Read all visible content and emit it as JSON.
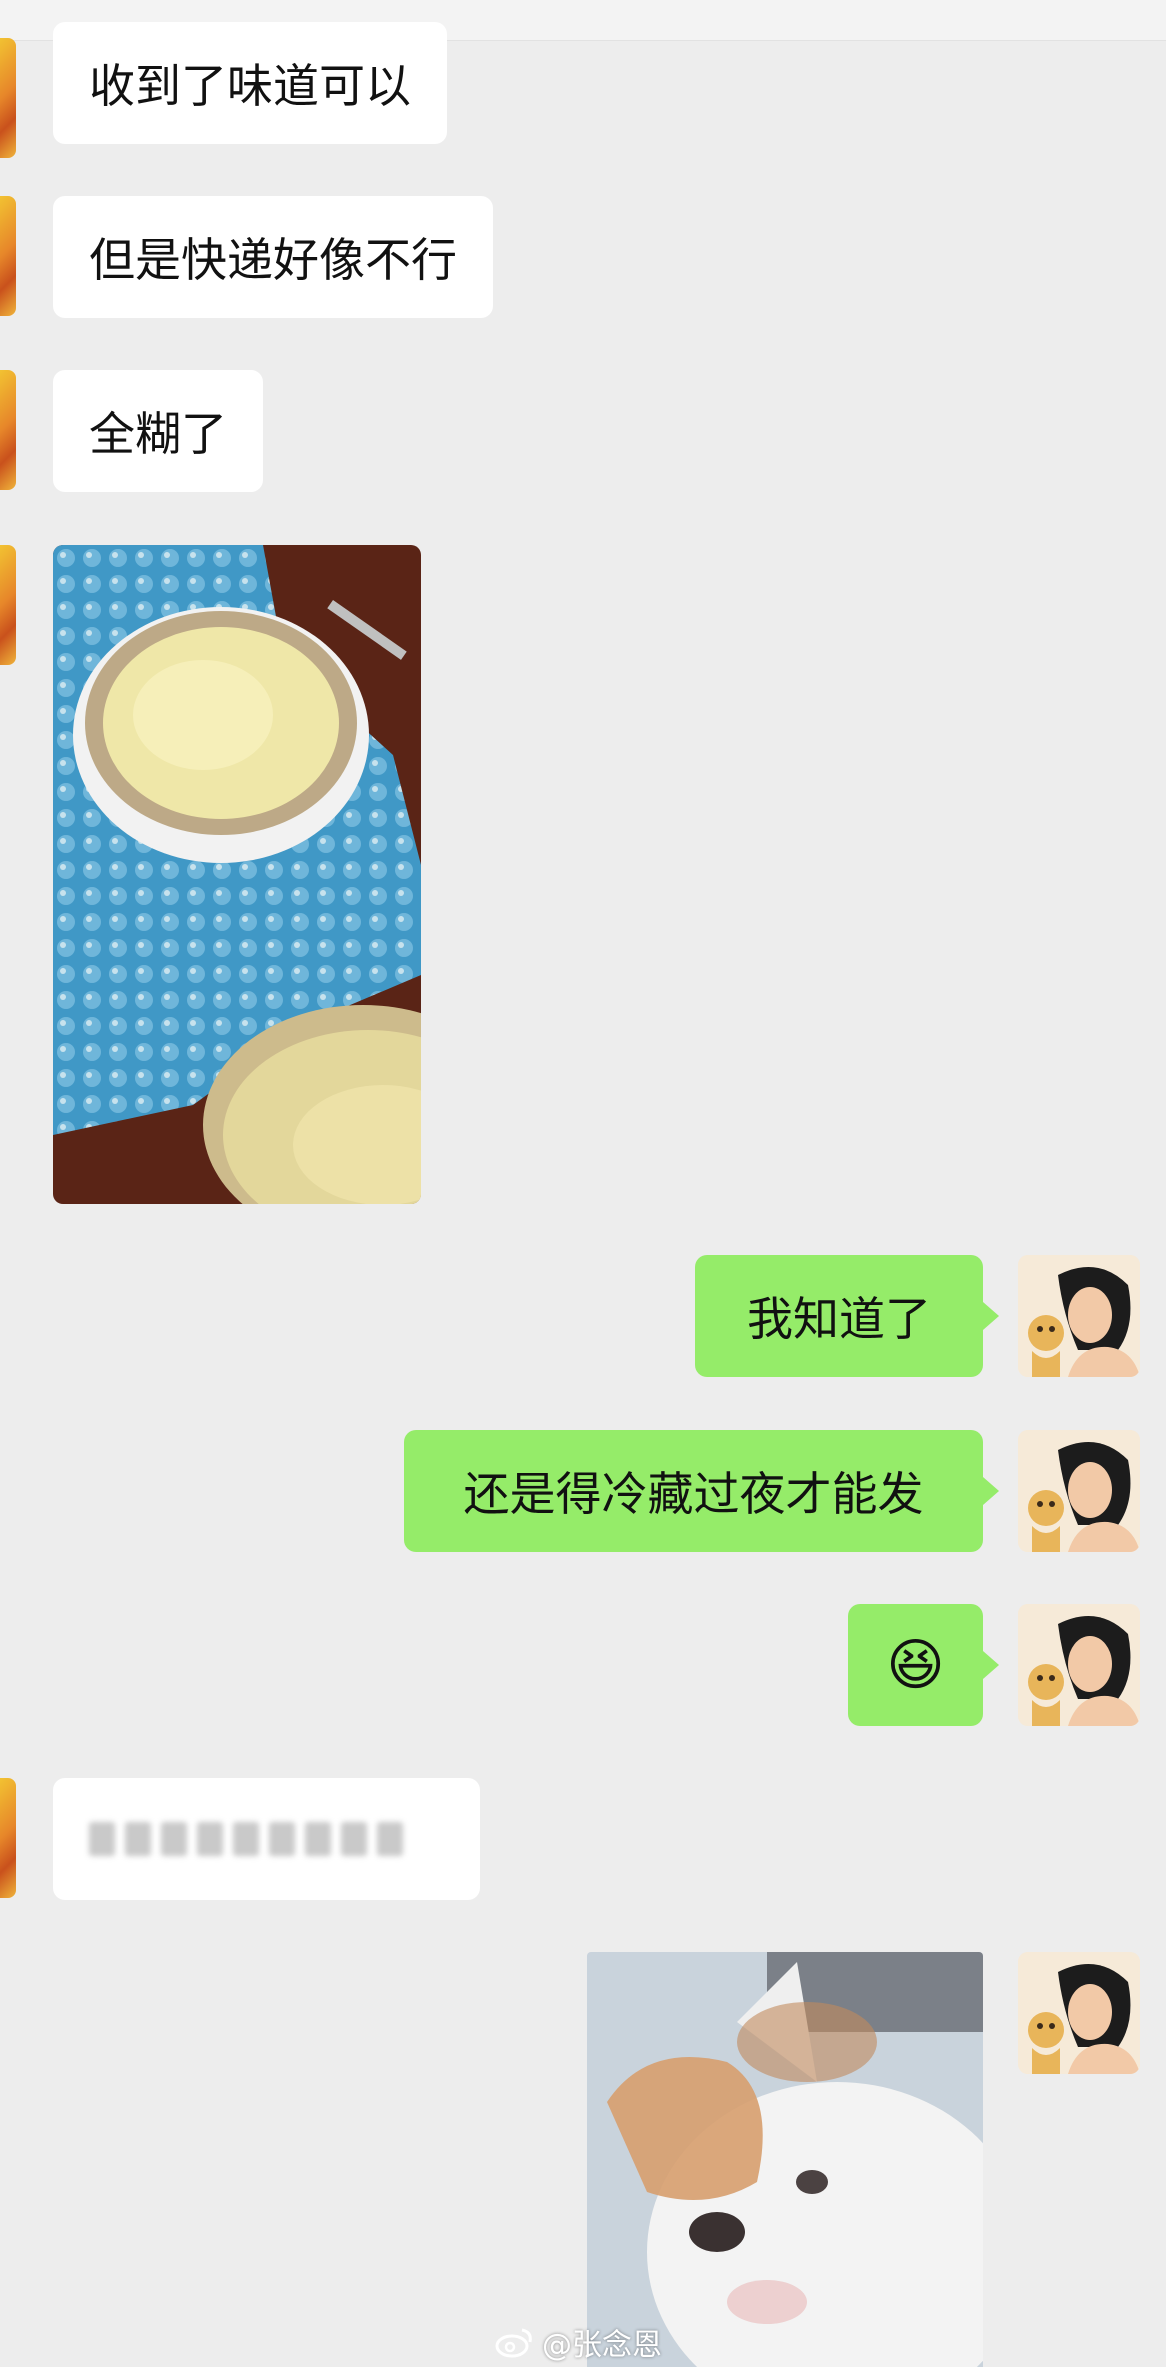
{
  "messages": {
    "m1": "收到了味道可以",
    "m2": "但是快递好像不行",
    "m3": "全糊了",
    "m5": "我知道了",
    "m6": "还是得冷藏过夜才能发",
    "m7_emoji": "😆"
  },
  "watermark": {
    "handle": "@张念恩"
  },
  "colors": {
    "chat_background": "#ededed",
    "incoming_bubble": "#ffffff",
    "outgoing_bubble": "#95ec69"
  },
  "icons": {
    "incoming_avatar": "cartoon-avatar-orange",
    "outgoing_avatar": "anime-portrait-with-cheetah",
    "watermark_logo": "weibo-icon"
  }
}
